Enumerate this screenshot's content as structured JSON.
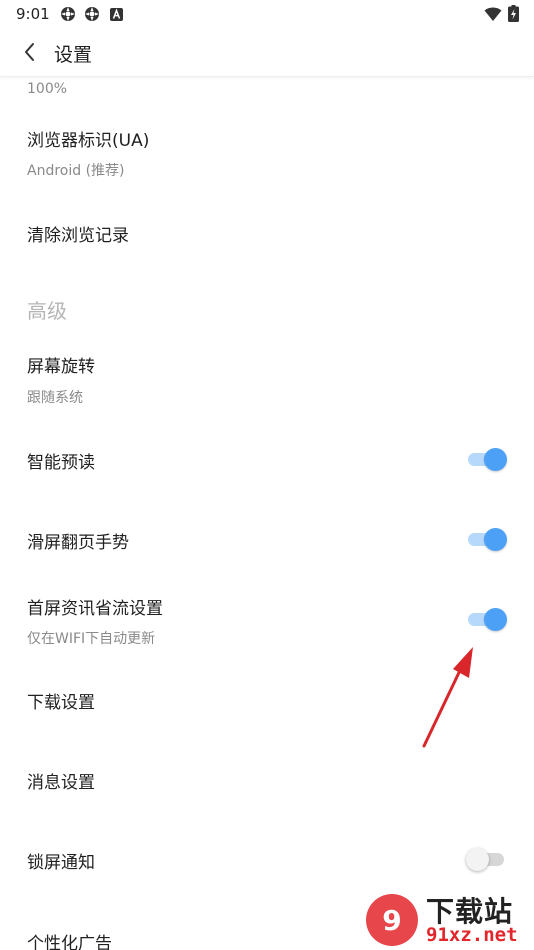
{
  "status_bar": {
    "time": "9:01",
    "icons": [
      "gear-icon",
      "gear-icon",
      "a-badge-icon"
    ],
    "right_icons": [
      "wifi-icon",
      "battery-icon"
    ]
  },
  "app_bar": {
    "back_icon": "chevron-left-icon",
    "title": "设置"
  },
  "settings": {
    "zoom_summary": "100%",
    "ua": {
      "title": "浏览器标识(UA)",
      "summary": "Android (推荐)"
    },
    "clear_history": {
      "title": "清除浏览记录"
    },
    "advanced_header": "高级",
    "screen_rotation": {
      "title": "屏幕旋转",
      "summary": "跟随系统"
    },
    "smart_preload": {
      "title": "智能预读",
      "enabled": true
    },
    "swipe_gesture": {
      "title": "滑屏翻页手势",
      "enabled": true
    },
    "data_saver": {
      "title": "首屏资讯省流设置",
      "summary": "仅在WIFI下自动更新",
      "enabled": true
    },
    "download_settings": {
      "title": "下载设置"
    },
    "message_settings": {
      "title": "消息设置"
    },
    "lock_screen_notify": {
      "title": "锁屏通知",
      "enabled": false
    },
    "personalized_ads": {
      "title": "个性化广告"
    }
  },
  "colors": {
    "accent": "#4ca0f5",
    "accent_track": "#b6d9fb",
    "annotation_arrow": "#d9262b"
  },
  "watermark": {
    "brand": "下载站",
    "domain": "91xz.net"
  }
}
